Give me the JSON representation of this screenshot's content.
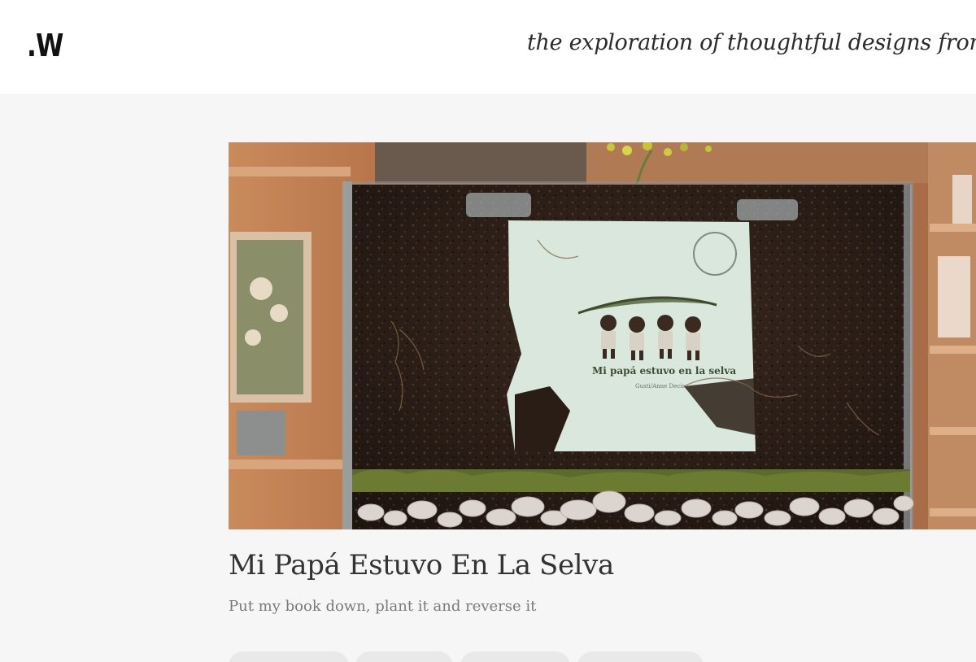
{
  "header": {
    "logo_text": ".W",
    "tagline": "the exploration of thoughtful designs from"
  },
  "article": {
    "image_alt": "",
    "book_cover_title": "Mi papá estuvo en la selva",
    "book_cover_author": "Gusti/Anne Decis",
    "title": "Mi Papá Estuvo En La Selva",
    "subtitle": "Put my book down, plant it and reverse it",
    "tags": [
      "",
      "",
      "",
      ""
    ]
  },
  "colors": {
    "header_bg": "#ffffff",
    "page_bg": "#f6f6f6",
    "title": "#333333",
    "subtitle": "#7a7a7a",
    "tag_bg": "#e9e9e9"
  }
}
